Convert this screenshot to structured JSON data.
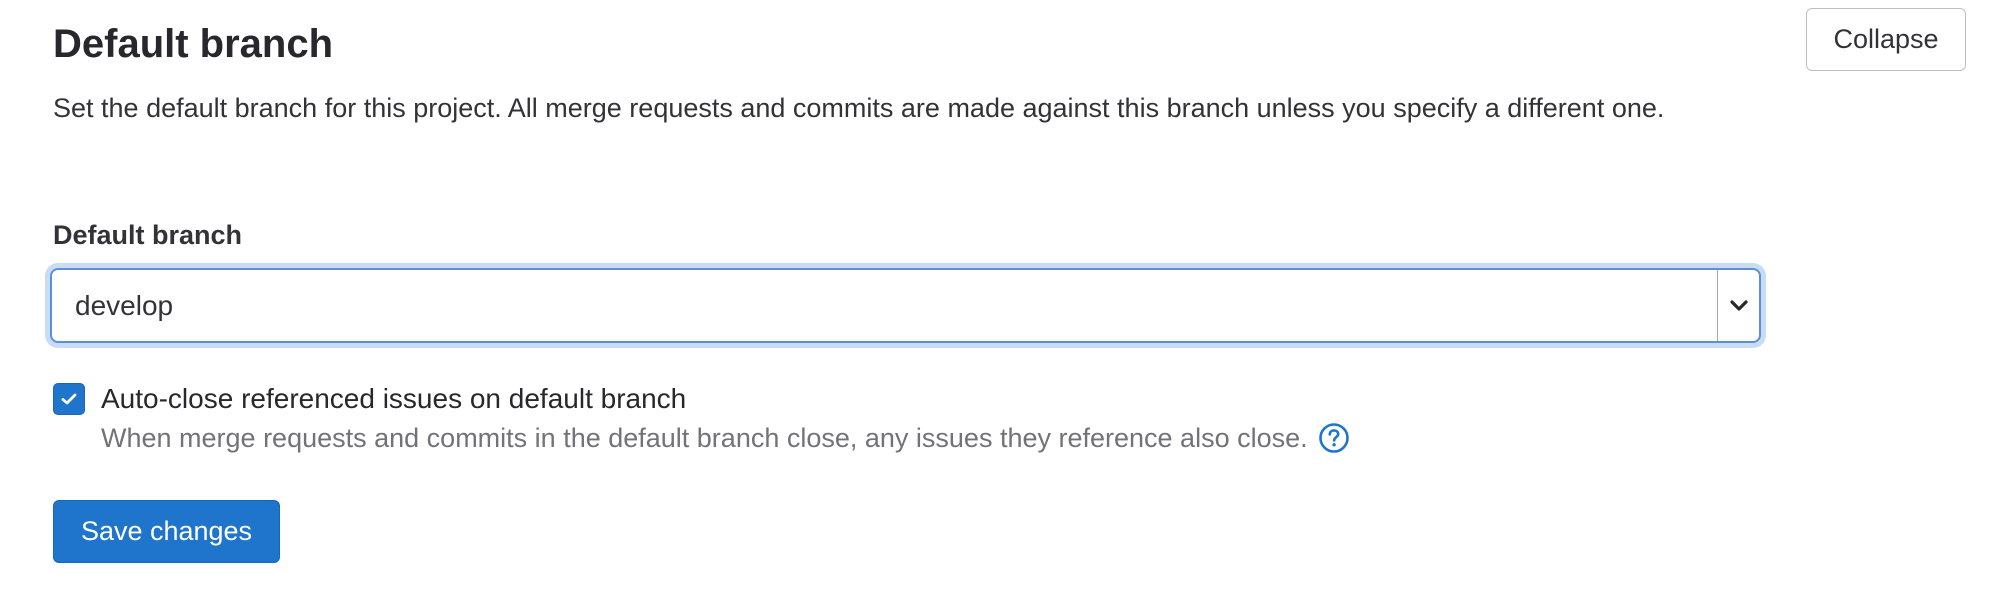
{
  "section": {
    "title": "Default branch",
    "collapse_label": "Collapse",
    "description": "Set the default branch for this project. All merge requests and commits are made against this branch unless you specify a different one."
  },
  "default_branch_field": {
    "label": "Default branch",
    "selected_value": "develop",
    "caret_icon": "chevron-down-icon"
  },
  "auto_close": {
    "checked": true,
    "label": "Auto-close referenced issues on default branch",
    "help_text": "When merge requests and commits in the default branch close, any issues they reference also close.",
    "help_icon": "question-circle-icon"
  },
  "actions": {
    "save_label": "Save changes"
  },
  "colors": {
    "primary": "#1f75cb",
    "focus_ring": "#c8dcf5",
    "muted_text": "#737278",
    "text": "#333238"
  }
}
